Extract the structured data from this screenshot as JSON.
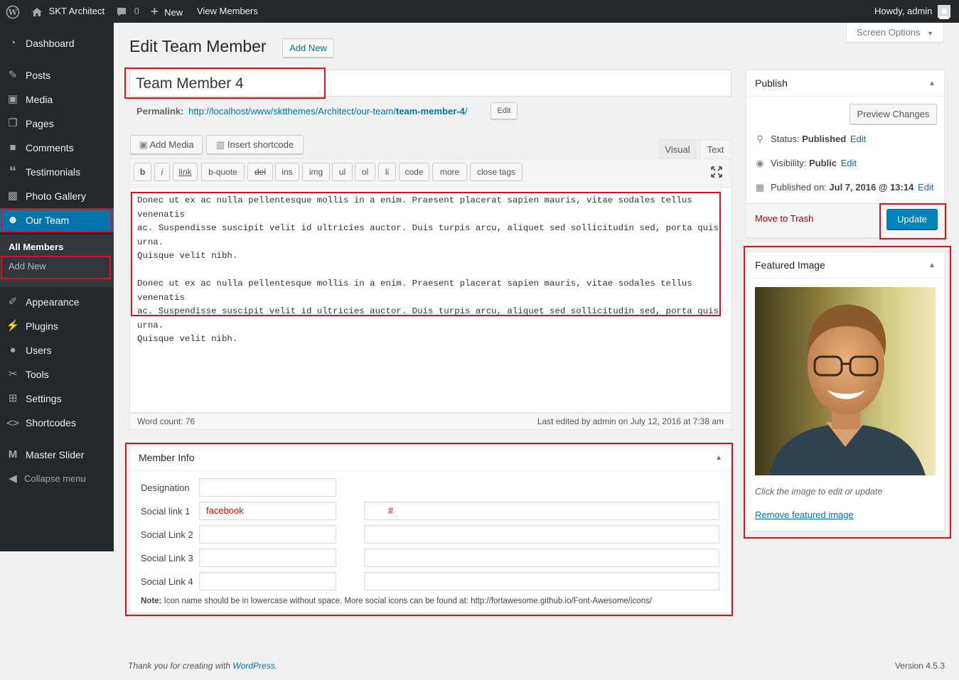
{
  "admin_bar": {
    "site_name": "SKT Architect",
    "comments_count": "0",
    "new_label": "New",
    "view_label": "View Members",
    "howdy": "Howdy, admin"
  },
  "sidebar": {
    "items": [
      {
        "label": "Dashboard",
        "icon": "dashboard-icon"
      },
      {
        "label": "Posts",
        "icon": "pin-icon"
      },
      {
        "label": "Media",
        "icon": "media-icon"
      },
      {
        "label": "Pages",
        "icon": "pages-icon"
      },
      {
        "label": "Comments",
        "icon": "comments-icon"
      },
      {
        "label": "Testimonials",
        "icon": "quote-icon"
      },
      {
        "label": "Photo Gallery",
        "icon": "gallery-icon"
      },
      {
        "label": "Our Team",
        "icon": "team-icon"
      },
      {
        "label": "Appearance",
        "icon": "brush-icon"
      },
      {
        "label": "Plugins",
        "icon": "plugin-icon"
      },
      {
        "label": "Users",
        "icon": "user-icon"
      },
      {
        "label": "Tools",
        "icon": "wrench-icon"
      },
      {
        "label": "Settings",
        "icon": "settings-icon"
      },
      {
        "label": "Shortcodes",
        "icon": "code-icon"
      },
      {
        "label": "Master Slider",
        "icon": "slider-icon"
      },
      {
        "label": "Collapse menu",
        "icon": "collapse-icon"
      }
    ],
    "submenu": [
      "All Members",
      "Add New"
    ]
  },
  "header": {
    "title": "Edit Team Member",
    "add_new": "Add New",
    "screen_options": "Screen Options"
  },
  "post": {
    "title": "Team Member 4",
    "permalink_label": "Permalink:",
    "permalink_base": "http://localhost/www/sktthemes/Architect/our-team/",
    "permalink_slug": "team-member-4",
    "permalink_end": "/",
    "permalink_edit": "Edit"
  },
  "editor": {
    "add_media": "Add Media",
    "insert_shortcode": "Insert shortcode",
    "tab_visual": "Visual",
    "tab_text": "Text",
    "quicktags": [
      "b",
      "i",
      "link",
      "b-quote",
      "del",
      "ins",
      "img",
      "ul",
      "ol",
      "li",
      "code",
      "more",
      "close tags"
    ],
    "paragraph1_line1": "Donec ut ex ac nulla pellentesque mollis in a enim. Praesent placerat sapien mauris, vitae sodales tellus venenatis",
    "paragraph1_line2": "ac. Suspendisse suscipit velit id ultricies auctor. Duis turpis arcu, aliquet sed sollicitudin sed, porta quis urna.",
    "paragraph1_line3": "Quisque velit nibh.",
    "paragraph2_line1": "Donec ut ex ac nulla pellentesque mollis in a enim. Praesent placerat sapien mauris, vitae sodales tellus venenatis",
    "paragraph2_line2": "ac. Suspendisse suscipit velit id ultricies auctor. Duis turpis arcu, aliquet sed sollicitudin sed, porta quis urna.",
    "paragraph2_line3": "Quisque velit nibh.",
    "word_count": "Word count: 76",
    "last_edited": "Last edited by admin on July 12, 2016 at 7:38 am"
  },
  "member_info": {
    "title": "Member Info",
    "rows": [
      {
        "label": "Designation",
        "value": "",
        "link": ""
      },
      {
        "label": "Social link 1",
        "value": "facebook",
        "link": "#"
      },
      {
        "label": "Social Link 2",
        "value": "",
        "link": ""
      },
      {
        "label": "Social Link 3",
        "value": "",
        "link": ""
      },
      {
        "label": "Social Link 4",
        "value": "",
        "link": ""
      }
    ],
    "note_bold": "Note:",
    "note_text": " Icon name should be in lowercase without space. More social icons can be found at: http://fortawesome.github.io/Font-Awesome/icons/"
  },
  "publish": {
    "title": "Publish",
    "preview": "Preview Changes",
    "status_label": "Status: ",
    "status_value": "Published",
    "visibility_label": "Visibility: ",
    "visibility_value": "Public",
    "published_label": "Published on: ",
    "published_value": "Jul 7, 2016 @ 13:14",
    "edit": "Edit",
    "trash": "Move to Trash",
    "update": "Update"
  },
  "featured": {
    "title": "Featured Image",
    "caption": "Click the image to edit or update",
    "remove": "Remove featured image"
  },
  "footer": {
    "thanks": "Thank you for creating with ",
    "wp": "WordPress",
    "period": ".",
    "version": "Version 4.5.3"
  },
  "colors": {
    "admin_dark": "#23282d",
    "accent": "#0073aa",
    "highlight": "#e2101f"
  }
}
